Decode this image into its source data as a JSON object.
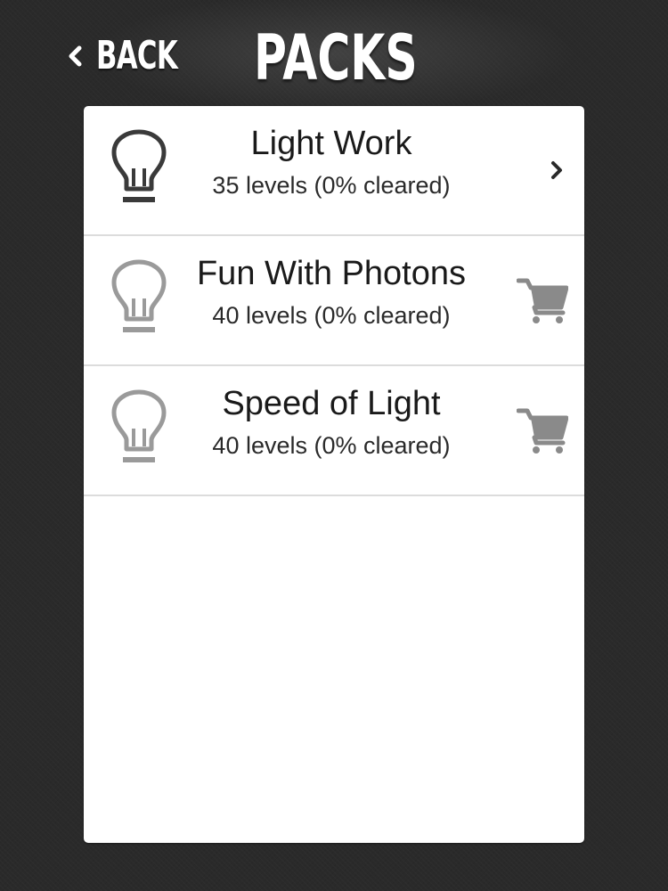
{
  "header": {
    "back_label": "BACK",
    "title": "PACKS",
    "back_icon": "chevron-left-icon"
  },
  "colors": {
    "background": "#2a2a2a",
    "panel": "#ffffff",
    "bulb_active": "#3a3a3a",
    "bulb_locked": "#9a9a9a",
    "cart": "#8a8a8a",
    "divider": "#dcdcdc"
  },
  "packs": [
    {
      "title": "Light Work",
      "subtitle": "35 levels (0% cleared)",
      "icon": "lightbulb-icon",
      "status": "unlocked",
      "action_icon": "chevron-right-icon"
    },
    {
      "title": "Fun With Photons",
      "subtitle": "40 levels (0% cleared)",
      "icon": "lightbulb-icon",
      "status": "locked",
      "action_icon": "cart-icon"
    },
    {
      "title": "Speed of Light",
      "subtitle": "40 levels (0% cleared)",
      "icon": "lightbulb-icon",
      "status": "locked",
      "action_icon": "cart-icon"
    }
  ]
}
